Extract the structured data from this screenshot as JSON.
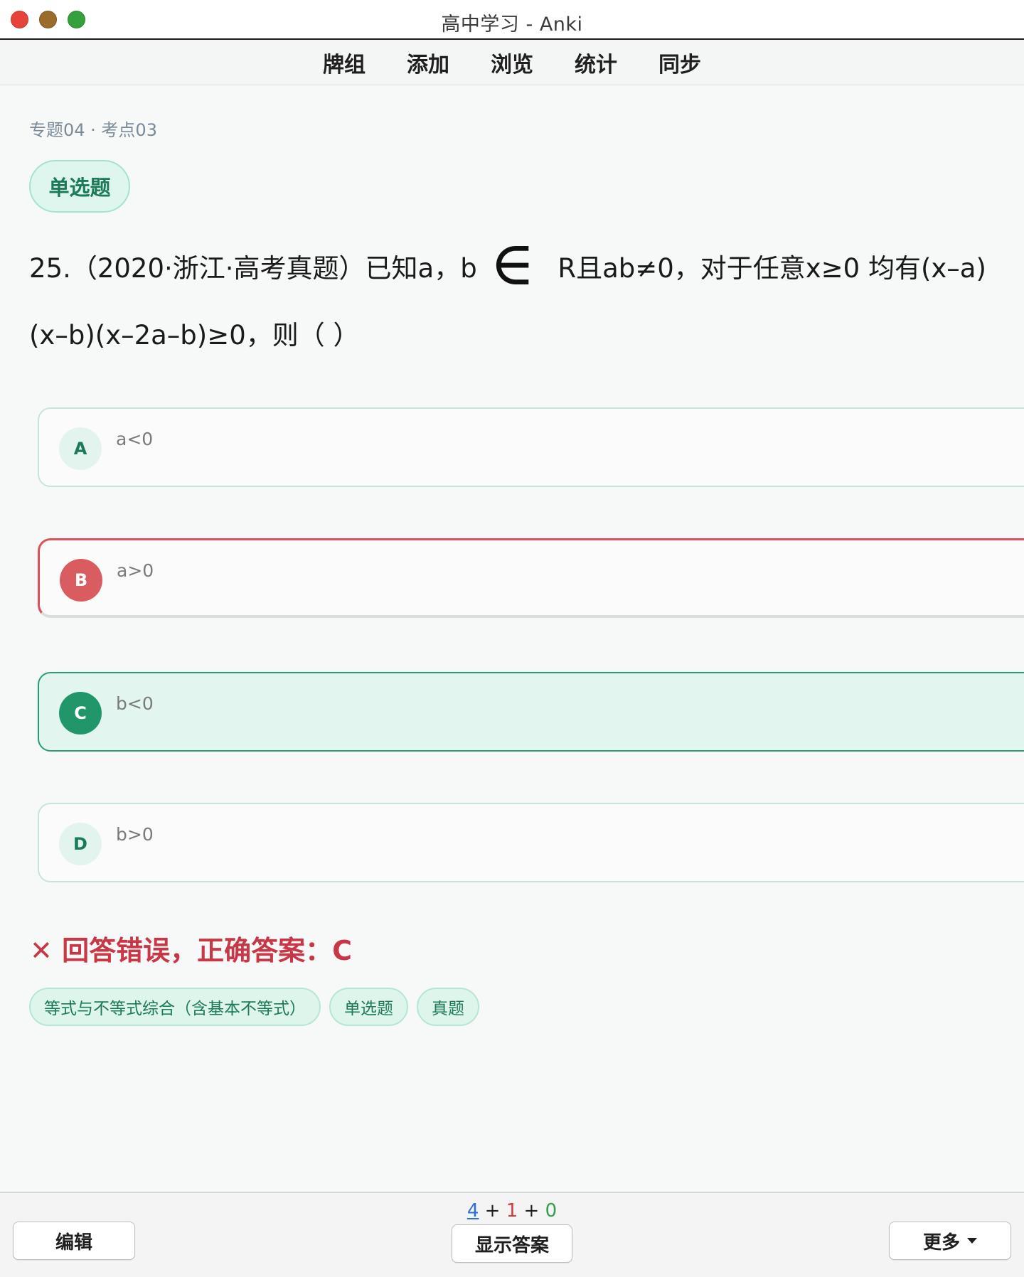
{
  "window": {
    "title": "高中学习 - Anki"
  },
  "toolbar": {
    "items": [
      "牌组",
      "添加",
      "浏览",
      "统计",
      "同步"
    ]
  },
  "card": {
    "breadcrumb": "专题04 · 考点03",
    "type_label": "单选题",
    "question_part1": "25.（2020·浙江·高考真题）已知a，b",
    "question_symbol": "∈",
    "question_part2": "R且ab≠0，对于任意x≥0 均有(x–a)(x–b)(x–2a–b)≥0，则（ ）",
    "options": [
      {
        "letter": "A",
        "text": "a<0",
        "state": "normal"
      },
      {
        "letter": "B",
        "text": "a>0",
        "state": "selected-wrong"
      },
      {
        "letter": "C",
        "text": "b<0",
        "state": "correct"
      },
      {
        "letter": "D",
        "text": "b>0",
        "state": "normal"
      }
    ],
    "result_icon": "✕",
    "result_text": "回答错误，正确答案：C",
    "tags": [
      "等式与不等式综合（含基本不等式）",
      "单选题",
      "真题"
    ]
  },
  "bottom": {
    "count_new": "4",
    "count_learn": "1",
    "count_review": "0",
    "plus": "+",
    "edit_label": "编辑",
    "show_answer_label": "显示答案",
    "more_label": "更多"
  },
  "colors": {
    "accent_green": "#1b7a58",
    "wrong_red": "#c83745",
    "correct_bg": "#e3f5ef"
  }
}
